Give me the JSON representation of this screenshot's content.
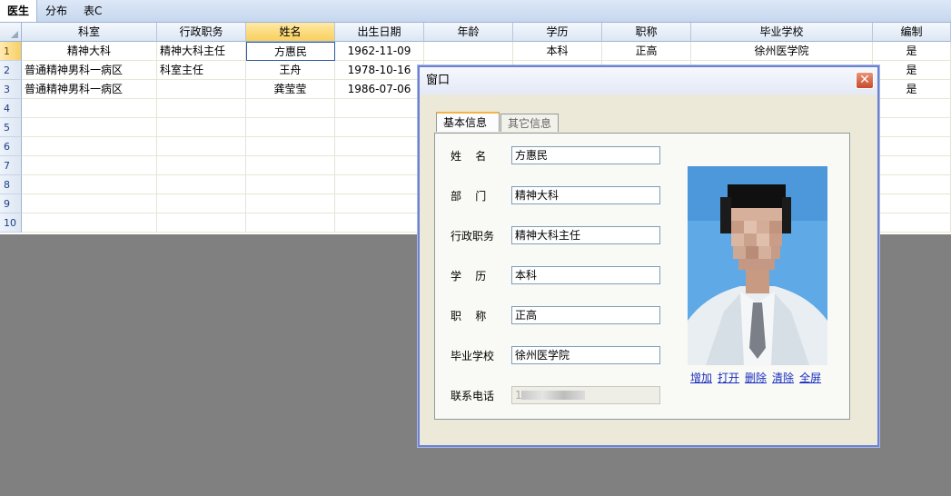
{
  "sheet_tabs": [
    "医生",
    "分布",
    "表C"
  ],
  "grid": {
    "columns": [
      "科室",
      "行政职务",
      "姓名",
      "出生日期",
      "年龄",
      "学历",
      "职称",
      "毕业学校",
      "编制"
    ],
    "row_numbers": [
      "1",
      "2",
      "3",
      "4",
      "5",
      "6",
      "7",
      "8",
      "9",
      "10"
    ],
    "rows": [
      [
        "精神大科",
        "精神大科主任",
        "方惠民",
        "1962-11-09",
        "",
        "本科",
        "正高",
        "徐州医学院",
        "是"
      ],
      [
        "普通精神男科一病区",
        "科室主任",
        "王舟",
        "1978-10-16",
        "",
        "",
        "",
        "",
        "是"
      ],
      [
        "普通精神男科一病区",
        "",
        "龚莹莹",
        "1986-07-06",
        "",
        "",
        "",
        "",
        "是"
      ]
    ]
  },
  "dialog": {
    "title": "窗口",
    "close_label": "✕",
    "tabs": [
      "基本信息",
      "其它信息"
    ],
    "fields": [
      {
        "label": "姓    名",
        "value": "方惠民"
      },
      {
        "label": "部    门",
        "value": "精神大科"
      },
      {
        "label": "行政职务",
        "value": "精神大科主任"
      },
      {
        "label": "学    历",
        "value": "本科"
      },
      {
        "label": "职    称",
        "value": "正高"
      },
      {
        "label": "毕业学校",
        "value": "徐州医学院"
      },
      {
        "label": "联系电话",
        "value": "1"
      }
    ],
    "photo_actions": [
      "增加",
      "打开",
      "删除",
      "清除",
      "全屏"
    ]
  },
  "colors": {
    "selection": "#f9cf5c",
    "dialog_border": "#6d83d0",
    "link": "#1a2fbf"
  }
}
